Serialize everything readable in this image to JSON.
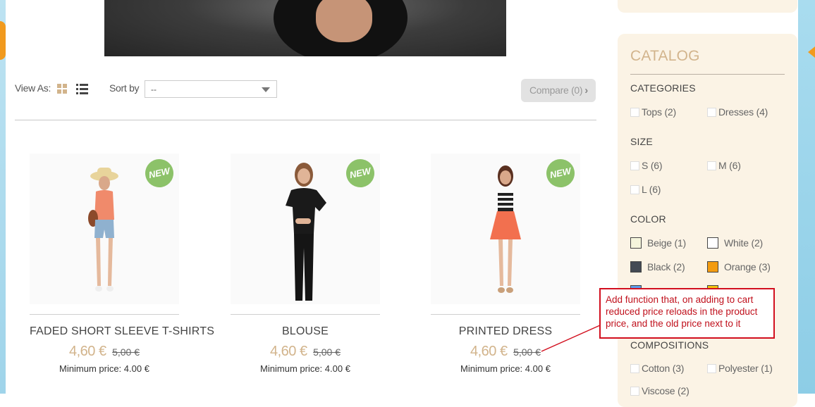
{
  "toolbar": {
    "view_as_label": "View As:",
    "sort_by_label": "Sort by",
    "sort_value": "--",
    "compare_label": "Compare (0)"
  },
  "products": [
    {
      "name": "FADED SHORT SLEEVE T-SHIRTS",
      "price": "4,60 €",
      "old_price": "5,00 €",
      "min_price": "Minimum price: 4.00 €",
      "badge": "NEW"
    },
    {
      "name": "BLOUSE",
      "price": "4,60 €",
      "old_price": "5,00 €",
      "min_price": "Minimum price: 4.00 €",
      "badge": "NEW"
    },
    {
      "name": "PRINTED DRESS",
      "price": "4,60 €",
      "old_price": "5,00 €",
      "min_price": "Minimum price: 4.00 €",
      "badge": "NEW"
    }
  ],
  "sidebar": {
    "title": "CATALOG",
    "categories_heading": "CATEGORIES",
    "categories": [
      "Tops (2)",
      "Dresses (4)"
    ],
    "size_heading": "SIZE",
    "sizes": [
      "S (6)",
      "M (6)",
      "L (6)"
    ],
    "color_heading": "COLOR",
    "colors": [
      {
        "label": "Beige (1)",
        "color": "#f5f5dc"
      },
      {
        "label": "White (2)",
        "color": "#ffffff"
      },
      {
        "label": "Black (2)",
        "color": "#434a54"
      },
      {
        "label": "Orange (3)",
        "color": "#f39c11"
      },
      {
        "color": "#5d9cec"
      },
      {
        "color": "#f1c40f"
      }
    ],
    "compositions_heading": "COMPOSITIONS",
    "compositions": [
      "Cotton (3)",
      "Polyester (1)",
      "Viscose (2)"
    ]
  },
  "annotation": {
    "text": "Add function that, on adding to cart reduced price reloads in the product price, and the old price next to it",
    "color": "#d20f1e"
  },
  "colors": {
    "accent": "#d2b48c",
    "sidebar_bg": "#fbf3e5",
    "new_badge": "#8cc269"
  }
}
